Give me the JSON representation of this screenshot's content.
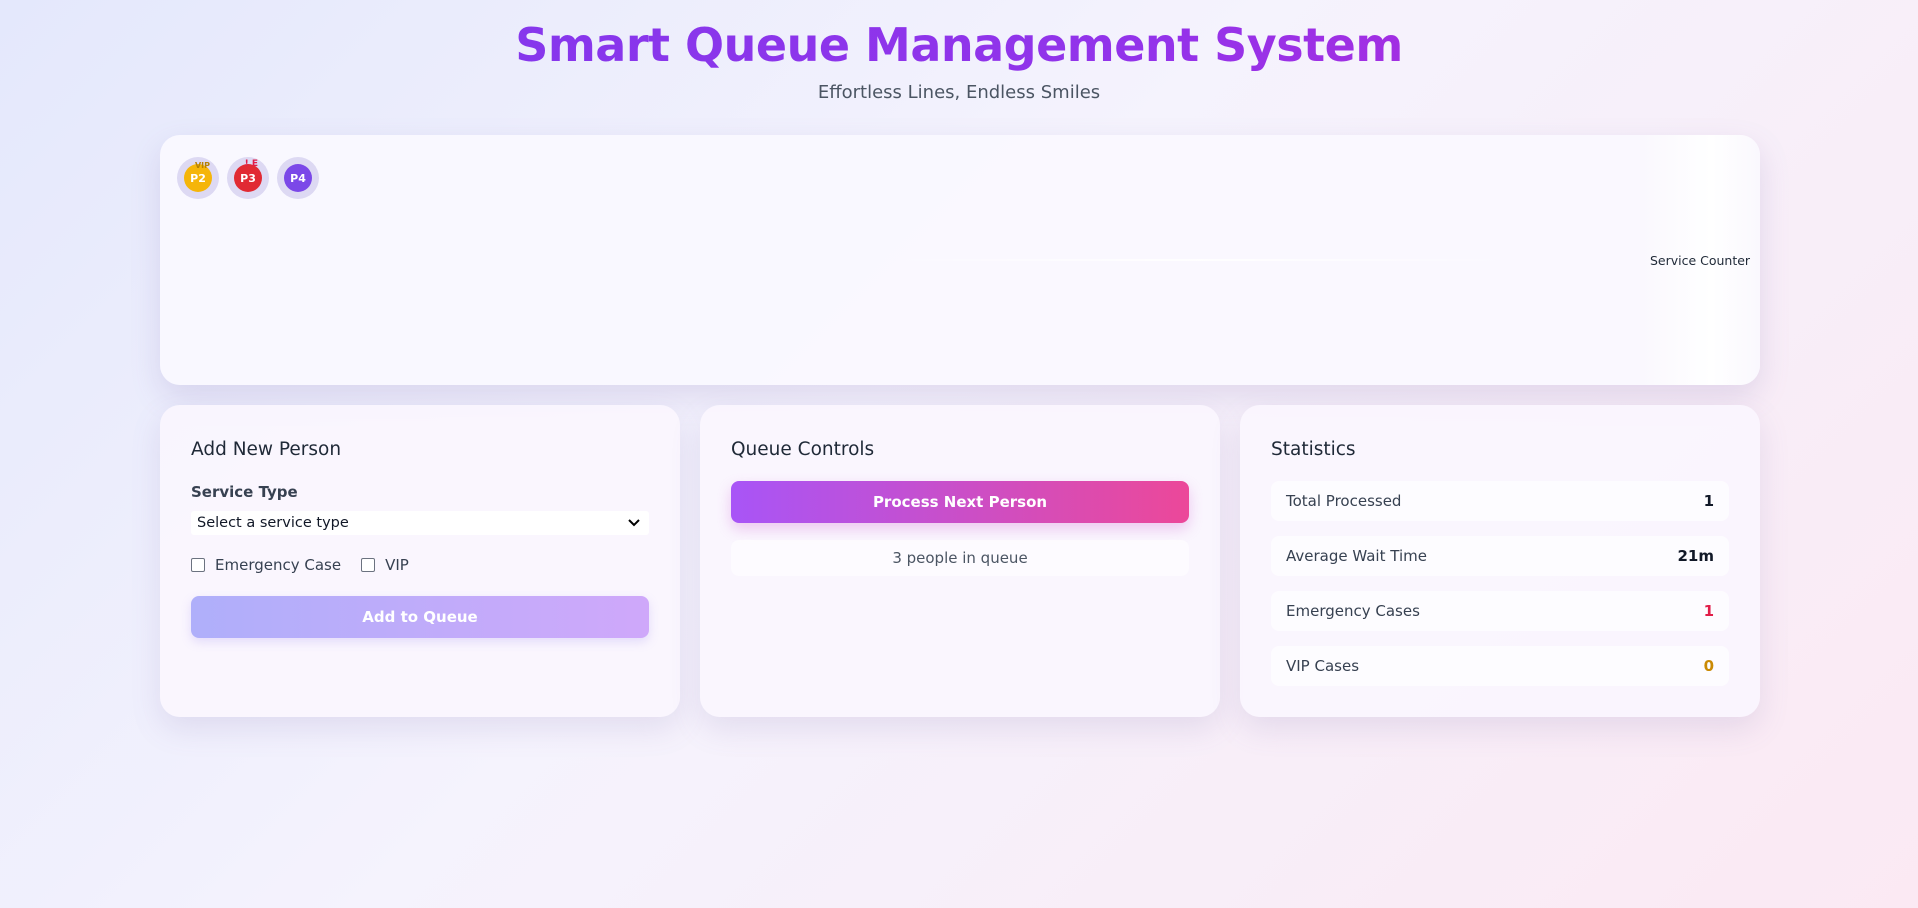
{
  "header": {
    "title": "Smart Queue Management System",
    "subtitle": "Effortless Lines, Endless Smiles"
  },
  "queue": {
    "people": [
      {
        "id": "P2",
        "tag": "VIP",
        "kind": "vip",
        "color": "#f5b50a"
      },
      {
        "id": "P3",
        "tag": "! E",
        "kind": "emergency",
        "color": "#e12a33"
      },
      {
        "id": "P4",
        "tag": "",
        "kind": "normal",
        "color": "#7b48e8"
      }
    ],
    "counter_label": "Service Counter"
  },
  "add_person": {
    "title": "Add New Person",
    "service_type_label": "Service Type",
    "service_type_value": "Select a service type",
    "emergency_label": "Emergency Case",
    "vip_label": "VIP",
    "add_button": "Add to Queue"
  },
  "controls": {
    "title": "Queue Controls",
    "process_button": "Process Next Person",
    "queue_status": "3 people in queue"
  },
  "statistics": {
    "title": "Statistics",
    "items": [
      {
        "label": "Total Processed",
        "value": "1"
      },
      {
        "label": "Average Wait Time",
        "value": "21m"
      },
      {
        "label": "Emergency Cases",
        "value": "1"
      },
      {
        "label": "VIP Cases",
        "value": "0"
      }
    ]
  },
  "colors": {
    "accent_start": "#a855f7",
    "accent_end": "#ec4899",
    "emergency": "#e11d48",
    "vip": "#ca8a04"
  }
}
